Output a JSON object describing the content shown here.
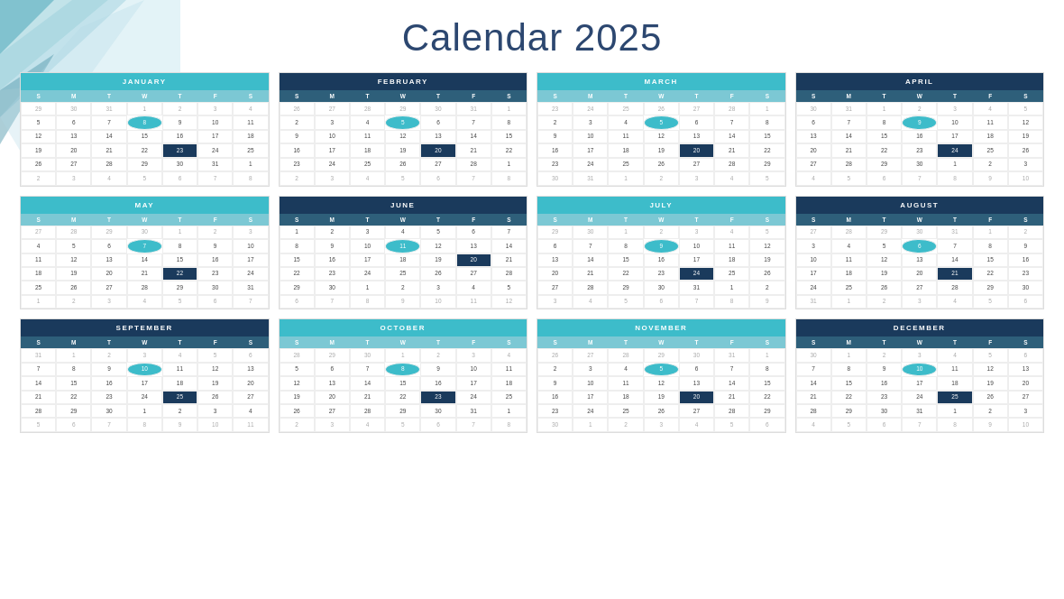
{
  "title": "Calendar 2025",
  "months": [
    {
      "name": "JANUARY",
      "headerClass": "teal",
      "dayNamesClass": "",
      "weeks": [
        [
          "29",
          "30",
          "31",
          "1",
          "2",
          "3",
          "4"
        ],
        [
          "5",
          "6",
          "7",
          "8",
          "9",
          "10",
          "11"
        ],
        [
          "12",
          "13",
          "14",
          "15",
          "16",
          "17",
          "18"
        ],
        [
          "19",
          "20",
          "21",
          "22",
          "23",
          "24",
          "25"
        ],
        [
          "26",
          "27",
          "28",
          "29",
          "30",
          "31",
          "1"
        ],
        [
          "2",
          "3",
          "4",
          "5",
          "6",
          "7",
          "8"
        ]
      ],
      "highlights": {
        "8": "teal",
        "23": "dark"
      },
      "faded": [
        "29",
        "30",
        "31",
        "1",
        "2",
        "3",
        "4",
        "2",
        "3",
        "4",
        "5",
        "6",
        "7",
        "8"
      ]
    },
    {
      "name": "FEBRUARY",
      "headerClass": "dark-blue",
      "dayNamesClass": "dark",
      "weeks": [
        [
          "26",
          "27",
          "28",
          "29",
          "30",
          "31",
          "1"
        ],
        [
          "2",
          "3",
          "4",
          "5",
          "6",
          "7",
          "8"
        ],
        [
          "9",
          "10",
          "11",
          "12",
          "13",
          "14",
          "15"
        ],
        [
          "16",
          "17",
          "18",
          "19",
          "20",
          "21",
          "22"
        ],
        [
          "23",
          "24",
          "25",
          "26",
          "27",
          "28",
          "1"
        ],
        [
          "2",
          "3",
          "4",
          "5",
          "6",
          "7",
          "8"
        ]
      ],
      "highlights": {
        "5": "teal",
        "20": "dark"
      },
      "faded": [
        "26",
        "27",
        "28",
        "29",
        "30",
        "31",
        "1",
        "2",
        "3",
        "4",
        "5",
        "6",
        "7",
        "8"
      ]
    },
    {
      "name": "MARCH",
      "headerClass": "teal",
      "dayNamesClass": "",
      "weeks": [
        [
          "23",
          "24",
          "25",
          "26",
          "27",
          "28",
          "1"
        ],
        [
          "2",
          "3",
          "4",
          "5",
          "6",
          "7",
          "8"
        ],
        [
          "9",
          "10",
          "11",
          "12",
          "13",
          "14",
          "15"
        ],
        [
          "16",
          "17",
          "18",
          "19",
          "20",
          "21",
          "22"
        ],
        [
          "23",
          "24",
          "25",
          "26",
          "27",
          "28",
          "29"
        ],
        [
          "30",
          "31",
          "1",
          "2",
          "3",
          "4",
          "5"
        ]
      ],
      "highlights": {
        "5": "teal",
        "20": "dark"
      },
      "faded": [
        "23",
        "24",
        "25",
        "26",
        "27",
        "28",
        "1",
        "2",
        "3",
        "4",
        "5"
      ]
    },
    {
      "name": "APRIL",
      "headerClass": "dark-blue",
      "dayNamesClass": "dark",
      "weeks": [
        [
          "30",
          "31",
          "1",
          "2",
          "3",
          "4",
          "5"
        ],
        [
          "6",
          "7",
          "8",
          "9",
          "10",
          "11",
          "12"
        ],
        [
          "13",
          "14",
          "15",
          "16",
          "17",
          "18",
          "19"
        ],
        [
          "20",
          "21",
          "22",
          "23",
          "24",
          "25",
          "26"
        ],
        [
          "27",
          "28",
          "29",
          "30",
          "1",
          "2",
          "3"
        ],
        [
          "4",
          "5",
          "6",
          "7",
          "8",
          "9",
          "10"
        ]
      ],
      "highlights": {
        "9": "teal",
        "24": "dark"
      },
      "faded": [
        "30",
        "31",
        "1",
        "2",
        "3",
        "4",
        "5",
        "1",
        "2",
        "3",
        "4",
        "5",
        "6",
        "7",
        "8",
        "9",
        "10"
      ]
    },
    {
      "name": "MAY",
      "headerClass": "teal",
      "dayNamesClass": "",
      "weeks": [
        [
          "27",
          "28",
          "29",
          "30",
          "1",
          "2",
          "3"
        ],
        [
          "4",
          "5",
          "6",
          "7",
          "8",
          "9",
          "10"
        ],
        [
          "11",
          "12",
          "13",
          "14",
          "15",
          "16",
          "17"
        ],
        [
          "18",
          "19",
          "20",
          "21",
          "22",
          "23",
          "24"
        ],
        [
          "25",
          "26",
          "27",
          "28",
          "29",
          "30",
          "31"
        ],
        [
          "1",
          "2",
          "3",
          "4",
          "5",
          "6",
          "7"
        ]
      ],
      "highlights": {
        "7": "teal",
        "22": "dark"
      },
      "faded": [
        "27",
        "28",
        "29",
        "30",
        "1",
        "2",
        "3",
        "4",
        "5",
        "6",
        "7"
      ]
    },
    {
      "name": "JUNE",
      "headerClass": "dark-blue",
      "dayNamesClass": "dark",
      "weeks": [
        [
          "1",
          "2",
          "3",
          "4",
          "5",
          "6",
          "7"
        ],
        [
          "8",
          "9",
          "10",
          "11",
          "12",
          "13",
          "14"
        ],
        [
          "15",
          "16",
          "17",
          "18",
          "19",
          "20",
          "21"
        ],
        [
          "22",
          "23",
          "24",
          "25",
          "26",
          "27",
          "28"
        ],
        [
          "29",
          "30",
          "1",
          "2",
          "3",
          "4",
          "5"
        ],
        [
          "6",
          "7",
          "8",
          "9",
          "10",
          "11",
          "12"
        ]
      ],
      "highlights": {
        "11": "teal",
        "20": "dark"
      },
      "faded": [
        "1",
        "2",
        "3",
        "4",
        "5",
        "6",
        "7",
        "8",
        "9",
        "10",
        "11",
        "12"
      ]
    },
    {
      "name": "JULY",
      "headerClass": "teal",
      "dayNamesClass": "",
      "weeks": [
        [
          "29",
          "30",
          "1",
          "2",
          "3",
          "4",
          "5"
        ],
        [
          "6",
          "7",
          "8",
          "9",
          "10",
          "11",
          "12"
        ],
        [
          "13",
          "14",
          "15",
          "16",
          "17",
          "18",
          "19"
        ],
        [
          "20",
          "21",
          "22",
          "23",
          "24",
          "25",
          "26"
        ],
        [
          "27",
          "28",
          "29",
          "30",
          "31",
          "1",
          "2"
        ],
        [
          "3",
          "4",
          "5",
          "6",
          "7",
          "8",
          "9"
        ]
      ],
      "highlights": {
        "9": "teal",
        "24": "dark"
      },
      "faded": [
        "29",
        "30",
        "1",
        "2",
        "3",
        "4",
        "5",
        "1",
        "2",
        "3",
        "4",
        "5",
        "6",
        "7",
        "8",
        "9"
      ]
    },
    {
      "name": "AUGUST",
      "headerClass": "dark-blue",
      "dayNamesClass": "dark",
      "weeks": [
        [
          "27",
          "28",
          "29",
          "30",
          "31",
          "1",
          "2"
        ],
        [
          "3",
          "4",
          "5",
          "6",
          "7",
          "8",
          "9"
        ],
        [
          "10",
          "11",
          "12",
          "13",
          "14",
          "15",
          "16"
        ],
        [
          "17",
          "18",
          "19",
          "20",
          "21",
          "22",
          "23"
        ],
        [
          "24",
          "25",
          "26",
          "27",
          "28",
          "29",
          "30"
        ],
        [
          "31",
          "1",
          "2",
          "3",
          "4",
          "5",
          "6"
        ]
      ],
      "highlights": {
        "6": "teal",
        "21": "dark"
      },
      "faded": [
        "27",
        "28",
        "29",
        "30",
        "31",
        "1",
        "2",
        "1",
        "2",
        "3",
        "4",
        "5",
        "6"
      ]
    },
    {
      "name": "SEPTEMBER",
      "headerClass": "dark-blue",
      "dayNamesClass": "dark",
      "weeks": [
        [
          "31",
          "1",
          "2",
          "3",
          "4",
          "5",
          "6"
        ],
        [
          "7",
          "8",
          "9",
          "10",
          "11",
          "12",
          "13"
        ],
        [
          "14",
          "15",
          "16",
          "17",
          "18",
          "19",
          "20"
        ],
        [
          "21",
          "22",
          "23",
          "24",
          "25",
          "26",
          "27"
        ],
        [
          "28",
          "29",
          "30",
          "1",
          "2",
          "3",
          "4"
        ],
        [
          "5",
          "6",
          "7",
          "8",
          "9",
          "10",
          "11"
        ]
      ],
      "highlights": {
        "10": "teal",
        "25": "dark"
      },
      "faded": [
        "31",
        "1",
        "2",
        "3",
        "4",
        "5",
        "6",
        "1",
        "2",
        "3",
        "4",
        "5",
        "6",
        "7",
        "8",
        "9",
        "10",
        "11"
      ]
    },
    {
      "name": "OCTOBER",
      "headerClass": "teal",
      "dayNamesClass": "",
      "weeks": [
        [
          "28",
          "29",
          "30",
          "1",
          "2",
          "3",
          "4"
        ],
        [
          "5",
          "6",
          "7",
          "8",
          "9",
          "10",
          "11"
        ],
        [
          "12",
          "13",
          "14",
          "15",
          "16",
          "17",
          "18"
        ],
        [
          "19",
          "20",
          "21",
          "22",
          "23",
          "24",
          "25"
        ],
        [
          "26",
          "27",
          "28",
          "29",
          "30",
          "31",
          "1"
        ],
        [
          "2",
          "3",
          "4",
          "5",
          "6",
          "7",
          "8"
        ]
      ],
      "highlights": {
        "8": "teal",
        "23": "dark"
      },
      "faded": [
        "28",
        "29",
        "30",
        "1",
        "2",
        "3",
        "4",
        "1",
        "2",
        "3",
        "4",
        "5",
        "6",
        "7",
        "8"
      ]
    },
    {
      "name": "NOVEMBER",
      "headerClass": "teal",
      "dayNamesClass": "",
      "weeks": [
        [
          "26",
          "27",
          "28",
          "29",
          "30",
          "31",
          "1"
        ],
        [
          "2",
          "3",
          "4",
          "5",
          "6",
          "7",
          "8"
        ],
        [
          "9",
          "10",
          "11",
          "12",
          "13",
          "14",
          "15"
        ],
        [
          "16",
          "17",
          "18",
          "19",
          "20",
          "21",
          "22"
        ],
        [
          "23",
          "24",
          "25",
          "26",
          "27",
          "28",
          "29"
        ],
        [
          "30",
          "1",
          "2",
          "3",
          "4",
          "5",
          "6"
        ]
      ],
      "highlights": {
        "5": "teal",
        "20": "dark"
      },
      "faded": [
        "26",
        "27",
        "28",
        "29",
        "30",
        "31",
        "1",
        "2",
        "3",
        "4",
        "5",
        "6"
      ]
    },
    {
      "name": "DECEMBER",
      "headerClass": "dark-blue",
      "dayNamesClass": "dark",
      "weeks": [
        [
          "30",
          "1",
          "2",
          "3",
          "4",
          "5",
          "6"
        ],
        [
          "7",
          "8",
          "9",
          "10",
          "11",
          "12",
          "13"
        ],
        [
          "14",
          "15",
          "16",
          "17",
          "18",
          "19",
          "20"
        ],
        [
          "21",
          "22",
          "23",
          "24",
          "25",
          "26",
          "27"
        ],
        [
          "28",
          "29",
          "30",
          "31",
          "1",
          "2",
          "3"
        ],
        [
          "4",
          "5",
          "6",
          "7",
          "8",
          "9",
          "10"
        ]
      ],
      "highlights": {
        "10": "teal",
        "25": "dark"
      },
      "faded": [
        "30",
        "1",
        "2",
        "3",
        "4",
        "5",
        "6",
        "1",
        "2",
        "3",
        "4",
        "5",
        "6",
        "7",
        "8",
        "9",
        "10"
      ]
    }
  ],
  "dayNames": [
    "S",
    "M",
    "T",
    "W",
    "T",
    "F",
    "S"
  ]
}
